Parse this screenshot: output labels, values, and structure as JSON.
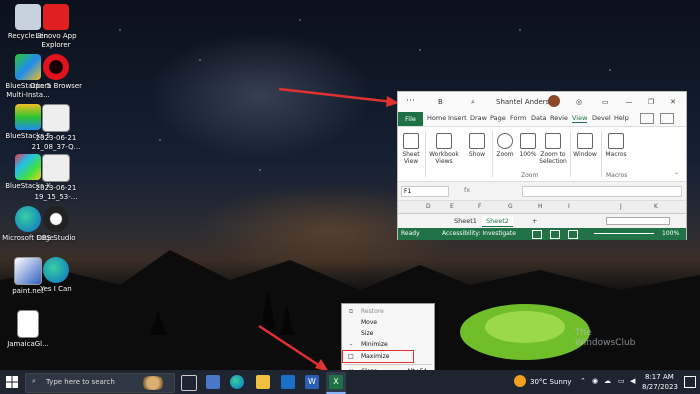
{
  "desktop_icons": [
    {
      "label": "Recycle Bin",
      "icon": "recycle-bin-icon"
    },
    {
      "label": "Lenovo App Explorer",
      "icon": "lenovo-app-explorer-icon"
    },
    {
      "label": "BlueStacks 5 Multi-Insta...",
      "icon": "bluestacks-multi-instance-icon"
    },
    {
      "label": "Opera Browser",
      "icon": "opera-icon"
    },
    {
      "label": "BlueStacks 5",
      "icon": "bluestacks-icon"
    },
    {
      "label": "2023-06-21 21_08_37-Q...",
      "icon": "image-file-icon"
    },
    {
      "label": "BlueStacks X",
      "icon": "bluestacks-x-icon"
    },
    {
      "label": "2023-06-21 19_15_53-...",
      "icon": "image-file-icon"
    },
    {
      "label": "Microsoft Edge",
      "icon": "edge-icon"
    },
    {
      "label": "OBS Studio",
      "icon": "obs-icon"
    },
    {
      "label": "paint.net",
      "icon": "paint-net-icon"
    },
    {
      "label": "Yes I Can",
      "icon": "edge-icon"
    },
    {
      "label": "JamaicaGl...",
      "icon": "document-icon"
    }
  ],
  "excel": {
    "user_name": "Shantel Anderson",
    "title_item": "B",
    "window_buttons": {
      "minimize": "—",
      "restore": "❐",
      "close": "✕"
    },
    "tabs": [
      "File",
      "Home",
      "Insert",
      "Draw",
      "Page",
      "Form",
      "Data",
      "Revie",
      "View",
      "Devel",
      "Help"
    ],
    "active_tab": "View",
    "ribbon": {
      "sheet_view": "Sheet View",
      "workbook_views": "Workbook Views",
      "show": "Show",
      "zoom": "Zoom",
      "zoom_100": "100%",
      "zoom_to_selection": "Zoom to Selection",
      "zoom_group": "Zoom",
      "window": "Window",
      "macros": "Macros",
      "macros_group": "Macros"
    },
    "name_box": "F1",
    "fx": "fx",
    "columns": [
      "D",
      "E",
      "F",
      "G",
      "H",
      "I",
      "J",
      "K"
    ],
    "sheets": [
      "Sheet1",
      "Sheet2"
    ],
    "active_sheet": "Sheet2",
    "add_sheet": "+",
    "status": {
      "ready": "Ready",
      "accessibility": "Accessibility: Investigate",
      "zoom": "100%"
    }
  },
  "context_menu": {
    "items": [
      {
        "mark": "⧉",
        "label": "Restore",
        "shortcut": "",
        "disabled": true
      },
      {
        "mark": "",
        "label": "Move",
        "shortcut": "",
        "disabled": false
      },
      {
        "mark": "",
        "label": "Size",
        "shortcut": "",
        "disabled": false
      },
      {
        "mark": "–",
        "label": "Minimize",
        "shortcut": "",
        "disabled": false
      },
      {
        "mark": "□",
        "label": "Maximize",
        "shortcut": "",
        "disabled": false
      },
      {
        "mark": "✕",
        "label": "Close",
        "shortcut": "Alt+F4",
        "disabled": false
      }
    ]
  },
  "taskbar": {
    "search_placeholder": "Type here to search",
    "weather": "30°C  Sunny",
    "time": "8:17 AM",
    "date": "8/27/2023"
  },
  "watermark": {
    "line1": "The",
    "line2": "WindowsClub"
  },
  "colors": {
    "excel_green": "#217346",
    "annotation_red": "#e03030"
  }
}
